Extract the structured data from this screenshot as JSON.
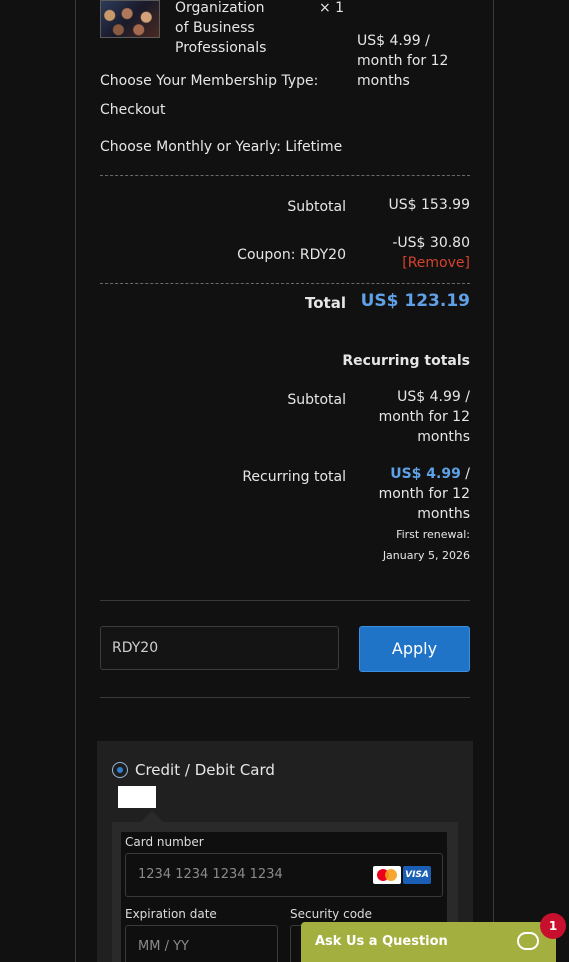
{
  "product": {
    "name_lines": [
      "Organization",
      "of Business",
      "Professionals"
    ],
    "quantity": "× 1",
    "price_lines": [
      "US$ 4.99 /",
      "month for 12",
      "months"
    ],
    "meta": [
      "Choose Your Membership Type:",
      "Checkout",
      "Choose Monthly or Yearly: Lifetime"
    ]
  },
  "totals": {
    "subtotal_label": "Subtotal",
    "subtotal_value": "US$ 153.99",
    "coupon_label": "Coupon: RDY20",
    "coupon_value": "-US$ 30.80",
    "coupon_remove": "[Remove]",
    "total_label": "Total",
    "total_value": "US$ 123.19"
  },
  "recurring": {
    "heading": "Recurring totals",
    "subtotal_label": "Subtotal",
    "subtotal_lines": [
      "US$ 4.99 /",
      "month for 12",
      "months"
    ],
    "total_label": "Recurring total",
    "total_amount": "US$ 4.99",
    "total_suffix": " /",
    "total_lines": [
      "month for 12",
      "months"
    ],
    "renewal_lines": [
      "First renewal:",
      "January 5, 2026"
    ]
  },
  "coupon_form": {
    "value": "RDY20",
    "apply_label": "Apply"
  },
  "payment": {
    "method_label": "Credit / Debit Card",
    "card_number_label": "Card number",
    "card_number_placeholder": "1234 1234 1234 1234",
    "expiration_label": "Expiration date",
    "expiration_placeholder": "MM / YY",
    "security_label": "Security code",
    "card_brands": [
      "mastercard-icon",
      "visa-icon"
    ],
    "visa_text": "VISA"
  },
  "chat_widget": {
    "label": "Ask Us a Question",
    "badge": "1"
  },
  "colors": {
    "background": "#111111",
    "accent": "#5fa0e6",
    "remove": "#d7422b",
    "apply_button": "#1f74c8",
    "chat_widget": "#a3b03f",
    "badge": "#c8102e"
  }
}
